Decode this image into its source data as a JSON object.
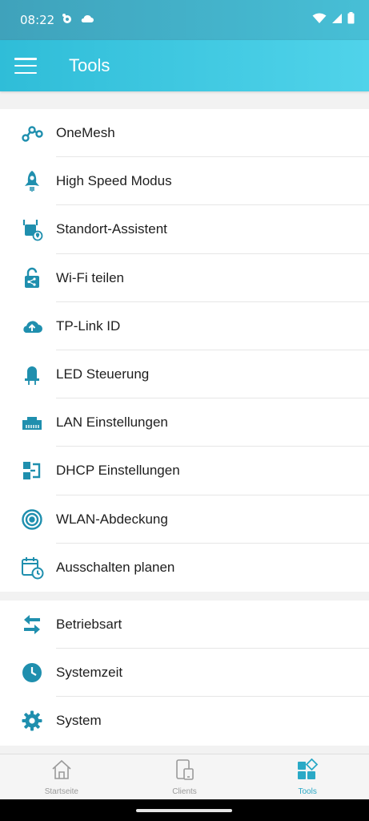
{
  "status_bar": {
    "time": "08:22",
    "icons": [
      "app-notification-icon",
      "cloud-icon",
      "wifi-icon",
      "cell-signal-icon",
      "battery-icon"
    ]
  },
  "app_bar": {
    "title": "Tools",
    "menu_icon": "hamburger-menu-icon"
  },
  "tools": [
    {
      "label": "OneMesh",
      "icon": "onemesh-icon"
    },
    {
      "label": "High Speed Modus",
      "icon": "rocket-icon"
    },
    {
      "label": "Standort-Assistent",
      "icon": "location-assistant-icon"
    },
    {
      "label": "Wi-Fi teilen",
      "icon": "share-lock-icon"
    },
    {
      "label": "TP-Link ID",
      "icon": "cloud-upload-icon"
    },
    {
      "label": "LED Steuerung",
      "icon": "led-icon"
    },
    {
      "label": "LAN Einstellungen",
      "icon": "lan-port-icon"
    },
    {
      "label": "DHCP Einstellungen",
      "icon": "dhcp-icon"
    },
    {
      "label": "WLAN-Abdeckung",
      "icon": "coverage-icon"
    },
    {
      "label": "Ausschalten planen",
      "icon": "schedule-icon"
    }
  ],
  "system_tools": [
    {
      "label": "Betriebsart",
      "icon": "swap-arrows-icon"
    },
    {
      "label": "Systemzeit",
      "icon": "clock-icon"
    },
    {
      "label": "System",
      "icon": "gear-icon"
    }
  ],
  "bottom_nav": [
    {
      "label": "Startseite",
      "icon": "home-icon",
      "active": false
    },
    {
      "label": "Clients",
      "icon": "devices-icon",
      "active": false
    },
    {
      "label": "Tools",
      "icon": "tools-grid-icon",
      "active": true
    }
  ],
  "colors": {
    "accent": "#2aa9c6",
    "icon": "#1f8fae",
    "appbar_start": "#2fbdd8",
    "appbar_end": "#50d3ea"
  }
}
